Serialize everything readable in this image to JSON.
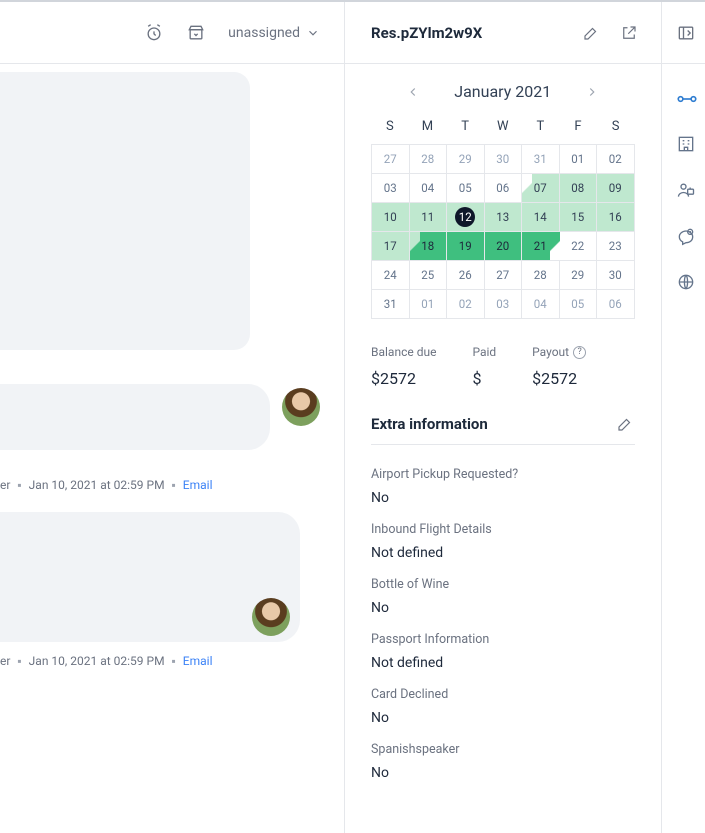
{
  "header": {
    "assign_label": "unassigned"
  },
  "messages": [
    {
      "author": "Housekeeper",
      "date": "Jan 10, 2021",
      "time_prefix": "at",
      "time": "02:59 PM",
      "channel": "Email"
    },
    {
      "author": "Housekeeper",
      "date": "Jan 10, 2021",
      "time_prefix": "at",
      "time": "02:59 PM",
      "channel": "Email"
    }
  ],
  "detail": {
    "title": "Res.pZYlm2w9X",
    "month_label": "January 2021",
    "daysOfWeek": [
      "S",
      "M",
      "T",
      "W",
      "T",
      "F",
      "S"
    ],
    "grid": [
      [
        {
          "n": "27",
          "c": "out"
        },
        {
          "n": "28",
          "c": "out"
        },
        {
          "n": "29",
          "c": "out"
        },
        {
          "n": "30",
          "c": "out"
        },
        {
          "n": "31",
          "c": "out"
        },
        {
          "n": "01"
        },
        {
          "n": "02"
        }
      ],
      [
        {
          "n": "03"
        },
        {
          "n": "04"
        },
        {
          "n": "05"
        },
        {
          "n": "06"
        },
        {
          "n": "07",
          "c": "range1 start1"
        },
        {
          "n": "08",
          "c": "range1"
        },
        {
          "n": "09",
          "c": "range1"
        }
      ],
      [
        {
          "n": "10",
          "c": "range1"
        },
        {
          "n": "11",
          "c": "range1"
        },
        {
          "n": "12",
          "c": "range1 today"
        },
        {
          "n": "13",
          "c": "range1"
        },
        {
          "n": "14",
          "c": "range1"
        },
        {
          "n": "15",
          "c": "range1"
        },
        {
          "n": "16",
          "c": "range1"
        }
      ],
      [
        {
          "n": "17",
          "c": "range1"
        },
        {
          "n": "18",
          "c": "range2 start2"
        },
        {
          "n": "19",
          "c": "range2"
        },
        {
          "n": "20",
          "c": "range2"
        },
        {
          "n": "21",
          "c": "range2 end2b"
        },
        {
          "n": "22"
        },
        {
          "n": "23"
        }
      ],
      [
        {
          "n": "24"
        },
        {
          "n": "25"
        },
        {
          "n": "26"
        },
        {
          "n": "27"
        },
        {
          "n": "28"
        },
        {
          "n": "29"
        },
        {
          "n": "30"
        }
      ],
      [
        {
          "n": "31"
        },
        {
          "n": "01",
          "c": "out"
        },
        {
          "n": "02",
          "c": "out"
        },
        {
          "n": "03",
          "c": "out"
        },
        {
          "n": "04",
          "c": "out"
        },
        {
          "n": "05",
          "c": "out"
        },
        {
          "n": "06",
          "c": "out"
        }
      ]
    ],
    "finance": {
      "balance_label": "Balance due",
      "balance_value": "$2572",
      "paid_label": "Paid",
      "paid_value": "$",
      "payout_label": "Payout",
      "payout_value": "$2572"
    },
    "extra_title": "Extra information",
    "fields": [
      {
        "label": "Airport Pickup Requested?",
        "value": "No"
      },
      {
        "label": "Inbound Flight Details",
        "value": "Not defined"
      },
      {
        "label": "Bottle of Wine",
        "value": "No"
      },
      {
        "label": "Passport Information",
        "value": "Not defined"
      },
      {
        "label": "Card Declined",
        "value": "No"
      },
      {
        "label": "Spanishspeaker",
        "value": "No"
      }
    ]
  }
}
